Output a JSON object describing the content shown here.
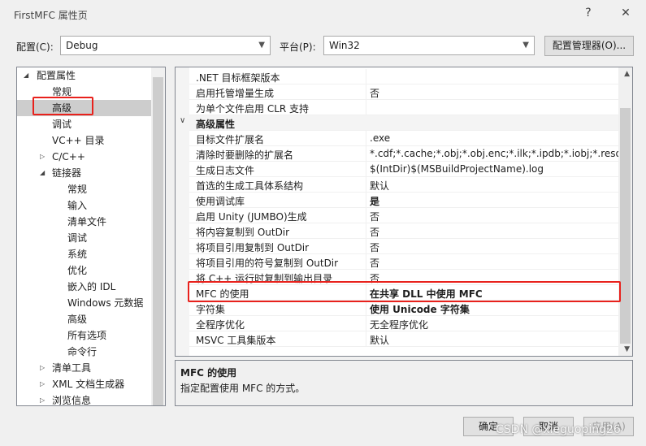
{
  "window": {
    "title": "FirstMFC 属性页",
    "help_icon": "?",
    "close_icon": "✕"
  },
  "toolbar": {
    "config_label": "配置(C):",
    "config_value": "Debug",
    "platform_label": "平台(P):",
    "platform_value": "Win32",
    "manager_button": "配置管理器(O)..."
  },
  "tree": {
    "items": [
      {
        "label": "配置属性",
        "state": "expanded"
      },
      {
        "label": "常规"
      },
      {
        "label": "高级",
        "selected": true
      },
      {
        "label": "调试"
      },
      {
        "label": "VC++ 目录"
      },
      {
        "label": "C/C++",
        "state": "collapsed"
      },
      {
        "label": "链接器",
        "state": "expanded"
      },
      {
        "label": "常规"
      },
      {
        "label": "输入"
      },
      {
        "label": "清单文件"
      },
      {
        "label": "调试"
      },
      {
        "label": "系统"
      },
      {
        "label": "优化"
      },
      {
        "label": "嵌入的 IDL"
      },
      {
        "label": "Windows 元数据"
      },
      {
        "label": "高级"
      },
      {
        "label": "所有选项"
      },
      {
        "label": "命令行"
      },
      {
        "label": "清单工具",
        "state": "collapsed"
      },
      {
        "label": "XML 文档生成器",
        "state": "collapsed"
      },
      {
        "label": "浏览信息",
        "state": "collapsed"
      }
    ]
  },
  "grid": {
    "rows": [
      {
        "name": ".NET 目标框架版本",
        "value": ""
      },
      {
        "name": "启用托管增量生成",
        "value": "否"
      },
      {
        "name": "为单个文件启用 CLR 支持",
        "value": ""
      },
      {
        "name": "高级属性",
        "value": "",
        "category": true
      },
      {
        "name": "目标文件扩展名",
        "value": ".exe"
      },
      {
        "name": "清除时要删除的扩展名",
        "value": "*.cdf;*.cache;*.obj;*.obj.enc;*.ilk;*.ipdb;*.iobj;*.resource"
      },
      {
        "name": "生成日志文件",
        "value": "$(IntDir)$(MSBuildProjectName).log"
      },
      {
        "name": "首选的生成工具体系结构",
        "value": "默认"
      },
      {
        "name": "使用调试库",
        "value": "是",
        "bold": true
      },
      {
        "name": "启用 Unity (JUMBO)生成",
        "value": "否"
      },
      {
        "name": "将内容复制到 OutDir",
        "value": "否"
      },
      {
        "name": "将项目引用复制到 OutDir",
        "value": "否"
      },
      {
        "name": "将项目引用的符号复制到 OutDir",
        "value": "否"
      },
      {
        "name": "将 C++ 运行时复制到输出目录",
        "value": "否"
      },
      {
        "name": "MFC 的使用",
        "value": "在共享 DLL 中使用 MFC",
        "bold": true
      },
      {
        "name": "字符集",
        "value": "使用 Unicode 字符集",
        "bold": true
      },
      {
        "name": "全程序优化",
        "value": "无全程序优化"
      },
      {
        "name": "MSVC 工具集版本",
        "value": "默认"
      }
    ]
  },
  "description": {
    "title": "MFC 的使用",
    "text": "指定配置使用 MFC 的方式。"
  },
  "buttons": {
    "ok": "确定",
    "cancel": "取消",
    "apply": "应用(A)"
  },
  "watermark": "CSDN @xieguoping26",
  "colors": {
    "highlight": "#e8211c",
    "selection": "#cce8ff"
  }
}
